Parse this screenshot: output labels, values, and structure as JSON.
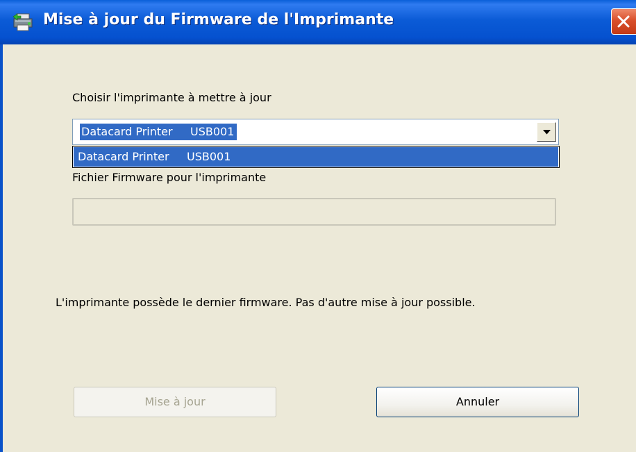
{
  "window": {
    "title": "Mise à jour du Firmware de l'Imprimante",
    "icon": "printer-update-icon",
    "colors": {
      "titlebar": "#0551cf",
      "background": "#ece9d8",
      "selection": "#316ac5",
      "close": "#d9502c"
    }
  },
  "form": {
    "printer_label": "Choisir l'imprimante à mettre à jour",
    "printer_selected": "Datacard Printer     USB001",
    "printer_options": [
      "Datacard Printer     USB001"
    ],
    "firmware_label": "Fichier Firmware pour l'imprimante",
    "firmware_value": "",
    "status_message": "L'imprimante possède le dernier firmware. Pas d'autre mise à jour possible."
  },
  "buttons": {
    "update_label": "Mise à jour",
    "cancel_label": "Annuler"
  }
}
